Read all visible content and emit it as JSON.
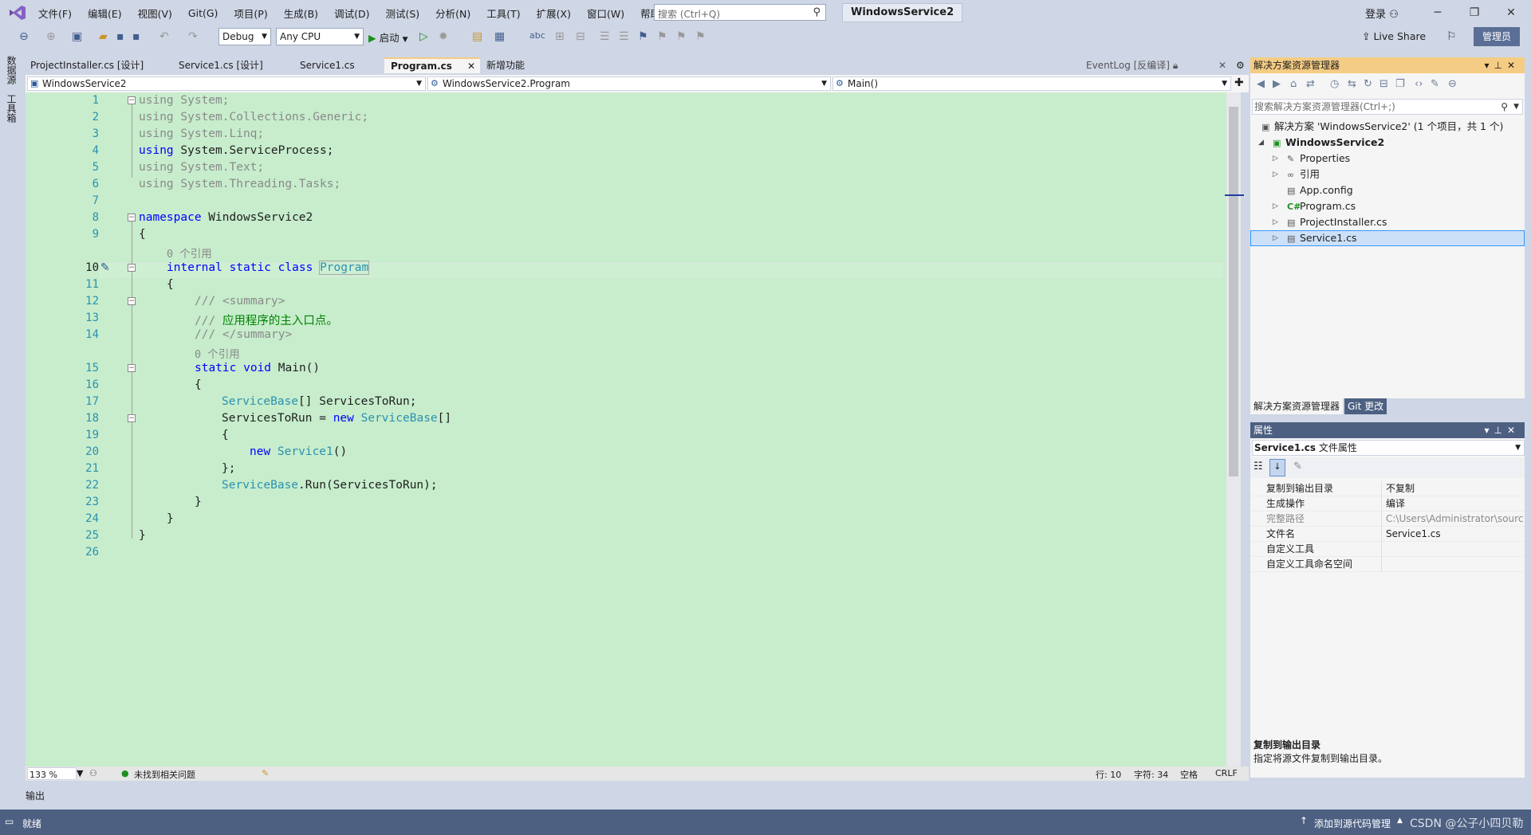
{
  "menu": {
    "items": [
      "文件(F)",
      "编辑(E)",
      "视图(V)",
      "Git(G)",
      "项目(P)",
      "生成(B)",
      "调试(D)",
      "测试(S)",
      "分析(N)",
      "工具(T)",
      "扩展(X)",
      "窗口(W)",
      "帮助(H)"
    ],
    "search_placeholder": "搜索 (Ctrl+Q)",
    "window_title": "WindowsService2",
    "login": "登录"
  },
  "toolbar": {
    "config": "Debug",
    "platform": "Any CPU",
    "start": "启动",
    "live_share": "Live Share",
    "admin": "管理员"
  },
  "left_tools": [
    "数据源",
    "工具箱"
  ],
  "tabs": [
    {
      "label": "ProjectInstaller.cs [设计]"
    },
    {
      "label": "Service1.cs [设计]"
    },
    {
      "label": "Service1.cs"
    },
    {
      "label": "Program.cs"
    },
    {
      "label": "新增功能"
    },
    {
      "label": "EventLog [反编译]"
    }
  ],
  "nav": {
    "project": "WindowsService2",
    "class": "WindowsService2.Program",
    "member": "Main()"
  },
  "code_lines": [
    {
      "n": "1"
    },
    {
      "n": "2"
    },
    {
      "n": "3"
    },
    {
      "n": "4"
    },
    {
      "n": "5"
    },
    {
      "n": "6"
    },
    {
      "n": "7"
    },
    {
      "n": "8"
    },
    {
      "n": "9"
    },
    {
      "n": "10"
    },
    {
      "n": "11"
    },
    {
      "n": "12"
    },
    {
      "n": "13"
    },
    {
      "n": "14"
    },
    {
      "n": "15"
    },
    {
      "n": "16"
    },
    {
      "n": "17"
    },
    {
      "n": "18"
    },
    {
      "n": "19"
    },
    {
      "n": "20"
    },
    {
      "n": "21"
    },
    {
      "n": "22"
    },
    {
      "n": "23"
    },
    {
      "n": "24"
    },
    {
      "n": "25"
    },
    {
      "n": "26"
    }
  ],
  "code": {
    "l1_kw": "using",
    "l1_rest": " System;",
    "l2_kw": "using",
    "l2_rest": " System.Collections.Generic;",
    "l3_kw": "using",
    "l3_rest": " System.Linq;",
    "l4_kw": "using",
    "l4_rest": " System.ServiceProcess;",
    "l5_kw": "using",
    "l5_rest": " System.Text;",
    "l6_kw": "using",
    "l6_rest": " System.Threading.Tasks;",
    "l8_kw": "namespace",
    "l8_rest": " WindowsService2",
    "brace_open": "{",
    "brace_close": "}",
    "refs": "0 个引用",
    "l10_kw": "internal static class",
    "l10_ty": "Program",
    "l12": "/// <summary>",
    "l13_prefix": "/// ",
    "l13_text": "应用程序的主入口点。",
    "l14": "/// </summary>",
    "l15_kw": "static void",
    "l15_rest": " Main()",
    "l17_ty": "ServiceBase",
    "l17_rest": "[] ServicesToRun;",
    "l18_a": "ServicesToRun = ",
    "l18_kw": "new",
    "l18_ty": " ServiceBase",
    "l18_rest": "[]",
    "l20_kw": "new",
    "l20_ty": " Service1",
    "l20_rest": "()",
    "l21": "};",
    "l22_ty": "ServiceBase",
    "l22_rest": ".Run(ServicesToRun);"
  },
  "editor_status": {
    "zoom": "133 %",
    "issues": "未找到相关问题",
    "line": "行: 10",
    "col": "字符: 34",
    "ws": "空格",
    "eol": "CRLF"
  },
  "output_tab": "输出",
  "solution_explorer": {
    "title": "解决方案资源管理器",
    "search": "搜索解决方案资源管理器(Ctrl+;)",
    "solution": "解决方案 'WindowsService2' (1 个项目，共 1 个)",
    "project": "WindowsService2",
    "items": [
      "Properties",
      "引用",
      "App.config",
      "Program.cs",
      "ProjectInstaller.cs",
      "Service1.cs"
    ],
    "tab_se": "解决方案资源管理器",
    "tab_git": "Git 更改"
  },
  "properties": {
    "title": "属性",
    "object": "Service1.cs",
    "object_suffix": "文件属性",
    "rows": [
      {
        "k": "复制到输出目录",
        "v": "不复制"
      },
      {
        "k": "生成操作",
        "v": "编译"
      },
      {
        "k": "完整路径",
        "v": "C:\\Users\\Administrator\\source"
      },
      {
        "k": "文件名",
        "v": "Service1.cs"
      },
      {
        "k": "自定义工具",
        "v": ""
      },
      {
        "k": "自定义工具命名空间",
        "v": ""
      }
    ],
    "desc_title": "复制到输出目录",
    "desc_text": "指定将源文件复制到输出目录。"
  },
  "statusbar": {
    "ready": "就绪",
    "source_control": "添加到源代码管理",
    "watermark": "CSDN @公子小四贝勒"
  },
  "colors": {
    "editor_bg": "#c7edcc",
    "chrome": "#cfd6e5",
    "status": "#4d6082",
    "accent_tab": "#f5cc84"
  }
}
